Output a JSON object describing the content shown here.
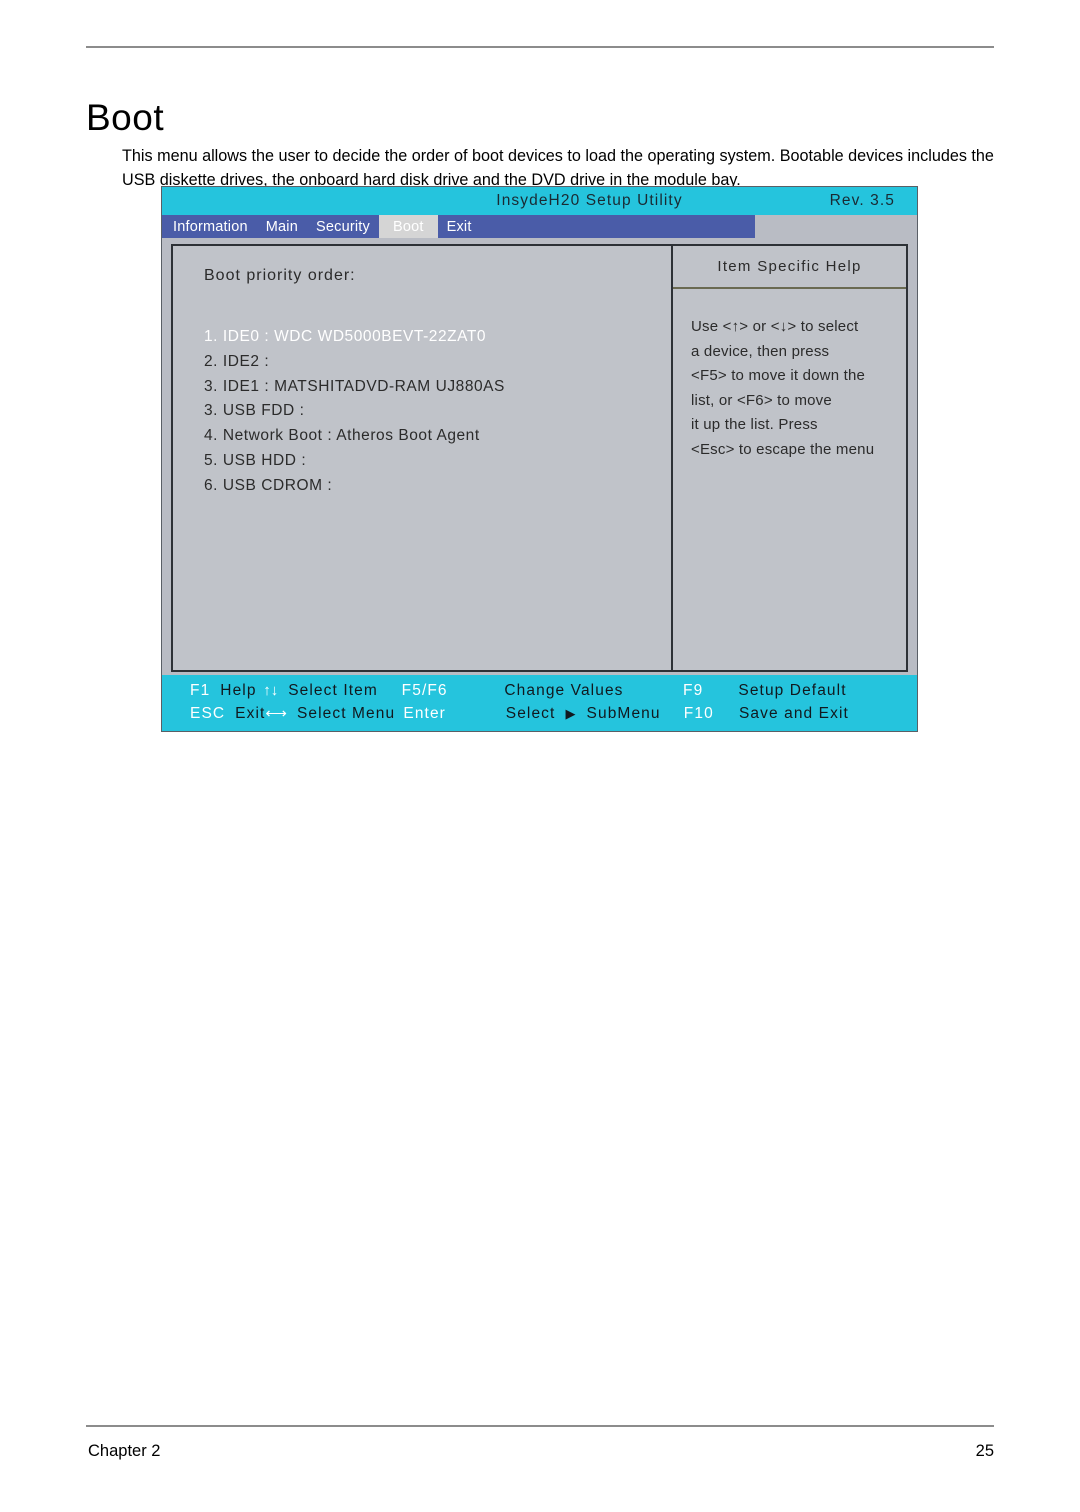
{
  "document": {
    "heading": "Boot",
    "intro": "This menu allows the user to decide the order of boot devices to load the operating system. Bootable devices includes the USB diskette drives, the onboard hard disk drive and the DVD drive in the module bay.",
    "footer_chapter": "Chapter 2",
    "footer_page": "25"
  },
  "bios": {
    "title": "InsydeH20 Setup Utility",
    "revision": "Rev. 3.5",
    "tabs": [
      {
        "label": "Information",
        "active": false
      },
      {
        "label": "Main",
        "active": false
      },
      {
        "label": "Security",
        "active": false
      },
      {
        "label": "Boot",
        "active": true
      },
      {
        "label": "Exit",
        "active": false
      }
    ],
    "boot": {
      "section_label": "Boot priority order:",
      "items": [
        {
          "text": "1. IDE0 : WDC WD5000BEVT-22ZAT0",
          "selected": true
        },
        {
          "text": "2. IDE2 :",
          "selected": false
        },
        {
          "text": "3. IDE1 : MATSHITADVD-RAM UJ880AS",
          "selected": false
        },
        {
          "text": "3. USB FDD :",
          "selected": false
        },
        {
          "text": "4. Network Boot : Atheros Boot Agent",
          "selected": false
        },
        {
          "text": "5. USB HDD :",
          "selected": false
        },
        {
          "text": "6. USB CDROM :",
          "selected": false
        }
      ]
    },
    "help": {
      "title": "Item Specific Help",
      "lines": [
        "Use <↑> or <↓> to select",
        "a device, then press",
        "<F5> to move it down the",
        "list, or <F6> to move",
        "it up the list. Press",
        "<Esc> to escape the menu"
      ]
    },
    "keybar": {
      "row1": [
        {
          "key": "F1",
          "arrow": "",
          "desc": "Help"
        },
        {
          "key": "",
          "arrow": "↑↓",
          "desc": "Select  Item"
        },
        {
          "key": "F5/F6",
          "arrow": "",
          "desc": "Change  Values"
        },
        {
          "key": "F9",
          "arrow": "",
          "desc": "Setup  Default"
        }
      ],
      "row2": [
        {
          "key": "ESC",
          "arrow": "",
          "desc": "Exit"
        },
        {
          "key": "",
          "arrow": "⟷",
          "desc": "Select  Menu"
        },
        {
          "key": "Enter",
          "arrow": "",
          "desc": "Select"
        },
        {
          "key": "",
          "arrow": "",
          "desc": "SubMenu"
        },
        {
          "key": "F10",
          "arrow": "",
          "desc": "Save  and  Exit"
        }
      ]
    }
  },
  "colors": {
    "bios_title_bg": "#25c4dd",
    "bios_tab_bg": "#4a5ca8",
    "bios_tab_active_bg": "#d5d5d5",
    "bios_panel_bg": "#c0c3c9",
    "bios_window_bg": "#b9bcc4",
    "selected_text": "#ffffff",
    "body_text": "#2b2b2b"
  }
}
